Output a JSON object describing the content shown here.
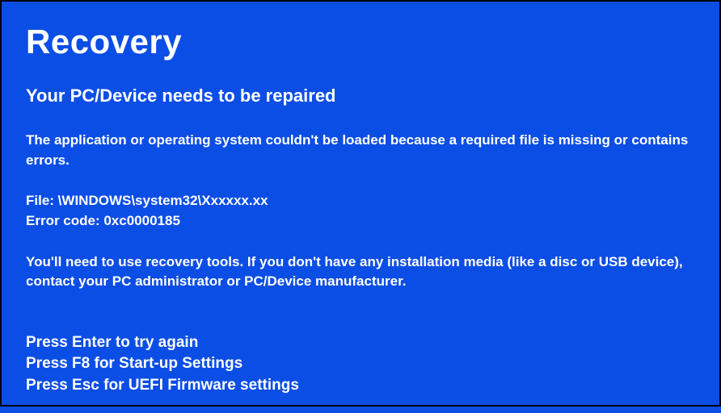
{
  "title": "Recovery",
  "subtitle": "Your PC/Device needs to be repaired",
  "reason": "The application or operating system couldn't be loaded because a required file is missing or contains errors.",
  "file_line": "File: \\WINDOWS\\system32\\Xxxxxx.xx",
  "error_line": "Error code: 0xc0000185",
  "instructions": "You'll need to use recovery tools. If you don't have any installation media (like a disc or USB device), contact your PC administrator or PC/Device manufacturer.",
  "options": {
    "enter": "Press Enter to try again",
    "f8": "Press F8 for Start-up Settings",
    "esc": "Press Esc for UEFI Firmware settings"
  }
}
